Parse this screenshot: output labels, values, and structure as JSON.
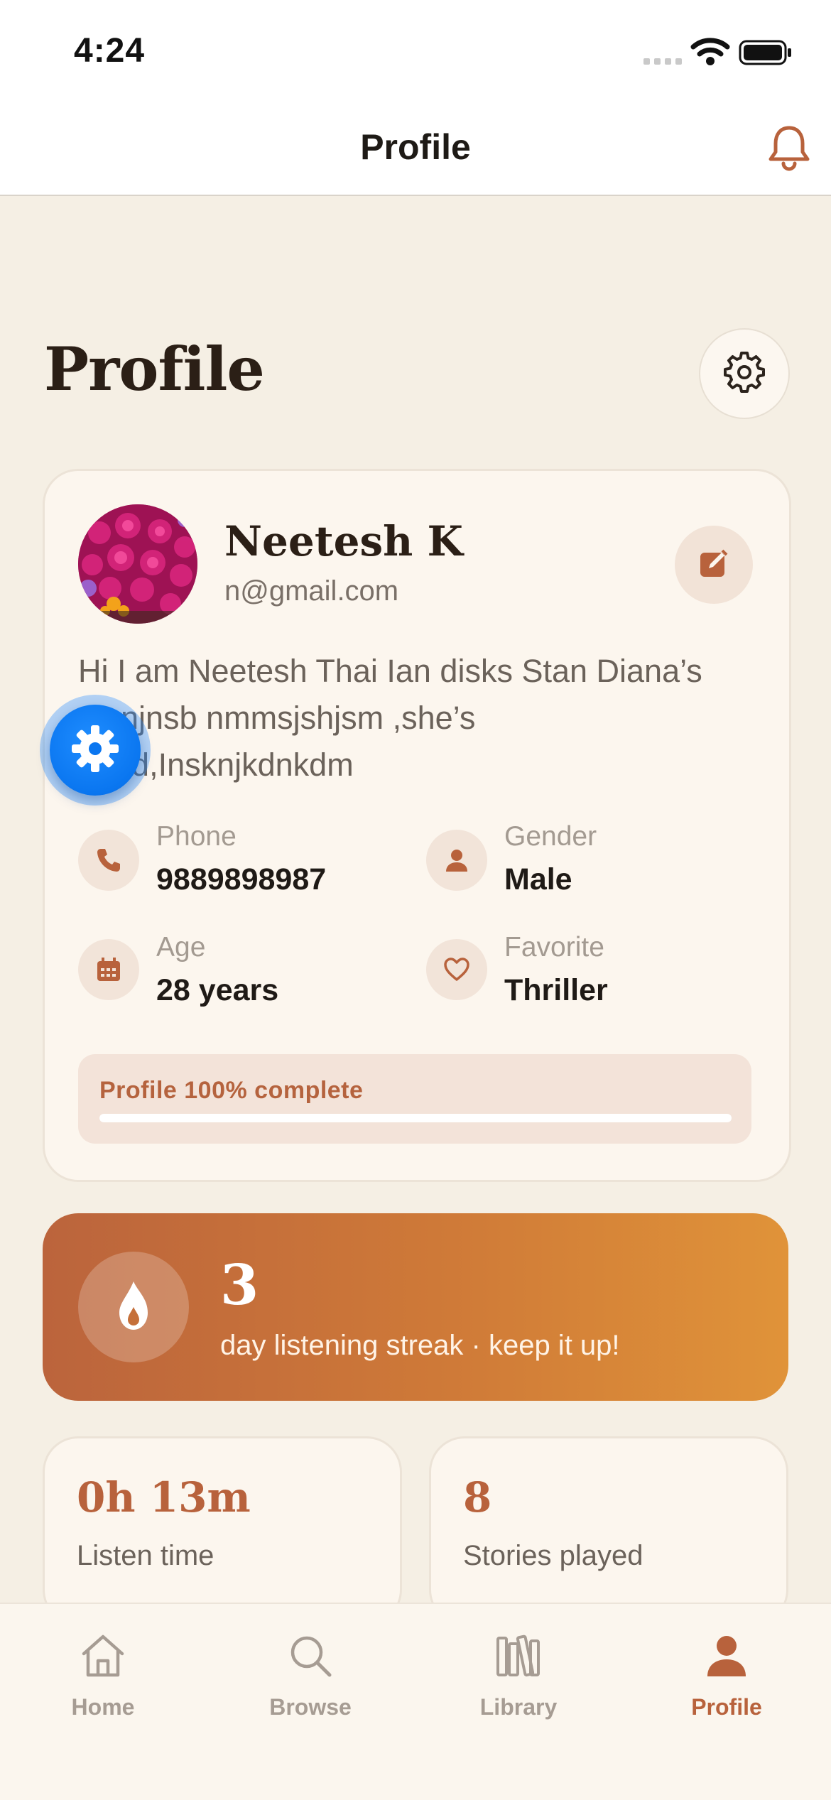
{
  "status_bar": {
    "time": "4:24"
  },
  "header": {
    "title": "Profile",
    "bell_icon": "bell-icon"
  },
  "page": {
    "title": "Profile",
    "settings_icon": "gear-icon"
  },
  "profile": {
    "name": "Neetesh K",
    "email": "n@gmail.com",
    "bio": "Hi I am Neetesh Thai Ian disks Stan Diana’s ...snjnsb nmmsjshjsm ,she’s ...n,d,Insknjkdnkdm",
    "edit_icon": "edit-icon",
    "fields": [
      {
        "label": "Phone",
        "value": "9889898987",
        "icon": "phone-icon"
      },
      {
        "label": "Gender",
        "value": "Male",
        "icon": "person-icon"
      },
      {
        "label": "Age",
        "value": "28 years",
        "icon": "calendar-icon"
      },
      {
        "label": "Favorite",
        "value": "Thriller",
        "icon": "heart-icon"
      }
    ],
    "completion": {
      "text": "Profile 100% complete",
      "fraction": 1.0
    }
  },
  "streak": {
    "count": "3",
    "text": "day listening streak · keep it up!",
    "icon": "flame-icon"
  },
  "stats": [
    {
      "value": "0h 13m",
      "label": "Listen time"
    },
    {
      "value": "8",
      "label": "Stories played"
    }
  ],
  "tabs": [
    {
      "label": "Home",
      "icon": "home-icon",
      "active": false
    },
    {
      "label": "Browse",
      "icon": "search-icon",
      "active": false
    },
    {
      "label": "Library",
      "icon": "library-icon",
      "active": false
    },
    {
      "label": "Profile",
      "icon": "person-icon",
      "active": true
    }
  ],
  "colors": {
    "accent": "#b8623c",
    "background": "#f5efe4",
    "card": "#fcf6ee",
    "fab": "#0a76f0"
  }
}
